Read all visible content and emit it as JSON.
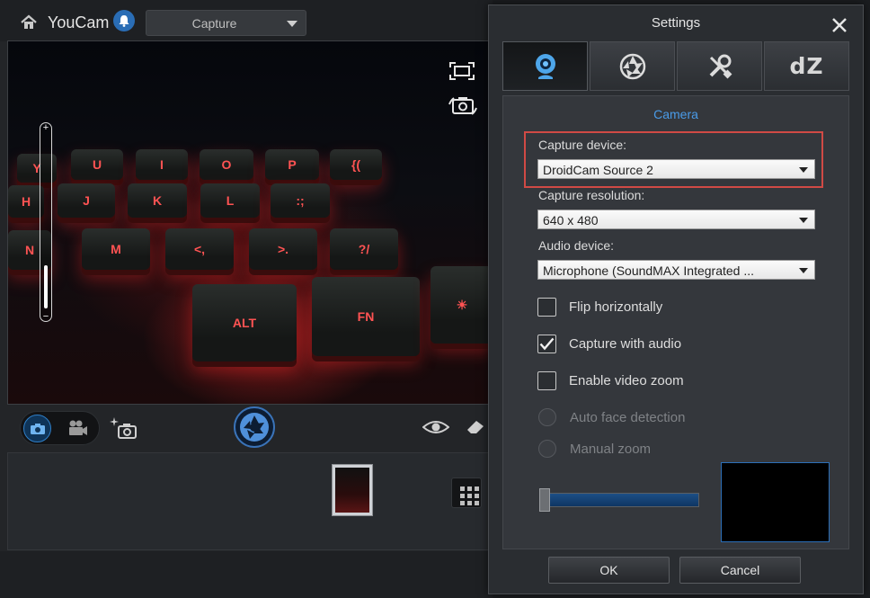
{
  "app": {
    "title": "YouCam",
    "mode_select": {
      "value": "Capture"
    }
  },
  "preview": {
    "zoom_plus": "+",
    "zoom_minus": "−",
    "zoom_level": 0.25,
    "keys": [
      "Y",
      "U",
      "I",
      "O",
      "P",
      "{(",
      "H",
      "J",
      "K",
      "L",
      ":;",
      "N",
      "M",
      "<,",
      ">.",
      "?/",
      "ALT",
      "FN",
      "☀"
    ]
  },
  "settings": {
    "title": "Settings",
    "tabs": [
      "camera-icon",
      "aperture-icon",
      "tools-icon",
      "dZ"
    ],
    "tab_dz_label": "dZ",
    "section_title": "Camera",
    "capture_device": {
      "label": "Capture device:",
      "value": "DroidCam Source 2"
    },
    "capture_resolution": {
      "label": "Capture resolution:",
      "value": "640 x 480"
    },
    "audio_device": {
      "label": "Audio device:",
      "value": "Microphone (SoundMAX Integrated ..."
    },
    "checkboxes": [
      {
        "label": "Flip horizontally",
        "checked": false
      },
      {
        "label": "Capture with audio",
        "checked": true
      },
      {
        "label": "Enable video zoom",
        "checked": false
      }
    ],
    "radios": [
      {
        "label": "Auto face detection",
        "enabled": false
      },
      {
        "label": "Manual zoom",
        "enabled": false
      }
    ],
    "zoom_slider_value": 0.0,
    "ok_label": "OK",
    "cancel_label": "Cancel"
  },
  "colors": {
    "accent": "#4a9be8",
    "highlight": "#d04a45",
    "keyboard_glow": "#ff5353"
  }
}
